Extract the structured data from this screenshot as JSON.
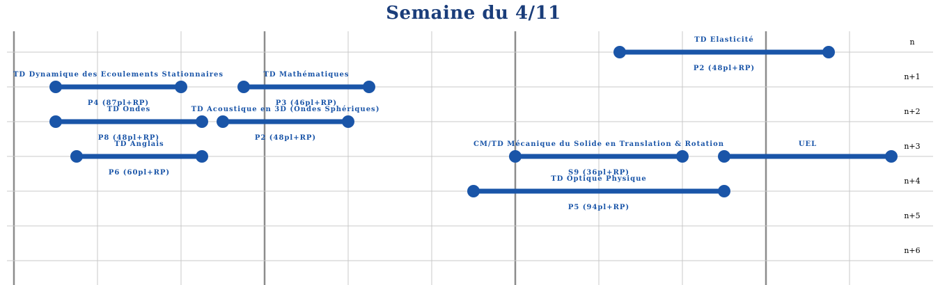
{
  "title": "Semaine du 4/11",
  "colors": {
    "title": "#1a3d7a",
    "bar": "#1a55a8",
    "label": "#1a55a8",
    "grid_minor": "#c8c8c8",
    "grid_major": "#8c8c8c"
  },
  "row_labels": [
    "n",
    "n+1",
    "n+2",
    "n+3",
    "n+4",
    "n+5",
    "n+6"
  ],
  "events": [
    {
      "title": "TD Elasticité",
      "room": "P2 (48pl+RP)",
      "row": 0,
      "start": 7.25,
      "end": 9.75
    },
    {
      "title": "TD Dynamique des Ecoulements Stationnaires",
      "room": "P4 (87pl+RP)",
      "row": 1,
      "start": 0.5,
      "end": 2.0
    },
    {
      "title": "TD Mathématiques",
      "room": "P3 (46pl+RP)",
      "row": 1,
      "start": 2.75,
      "end": 4.25
    },
    {
      "title": "TD Ondes",
      "room": "P8 (48pl+RP)",
      "row": 2,
      "start": 0.5,
      "end": 2.25
    },
    {
      "title": "TD Acoustique en 3D (Ondes Sphériques)",
      "room": "P2 (48pl+RP)",
      "row": 2,
      "start": 2.5,
      "end": 4.0
    },
    {
      "title": "TD Anglais",
      "room": "P6 (60pl+RP)",
      "row": 3,
      "start": 0.75,
      "end": 2.25
    },
    {
      "title": "CM/TD Mécanique du Solide en Translation & Rotation",
      "room": "S9 (36pl+RP)",
      "row": 3,
      "start": 6.0,
      "end": 8.0
    },
    {
      "title": "UEL",
      "room": "",
      "row": 3,
      "start": 8.5,
      "end": 10.5
    },
    {
      "title": "TD Optique Physique",
      "room": "P5 (94pl+RP)",
      "row": 4,
      "start": 5.5,
      "end": 8.5
    }
  ]
}
